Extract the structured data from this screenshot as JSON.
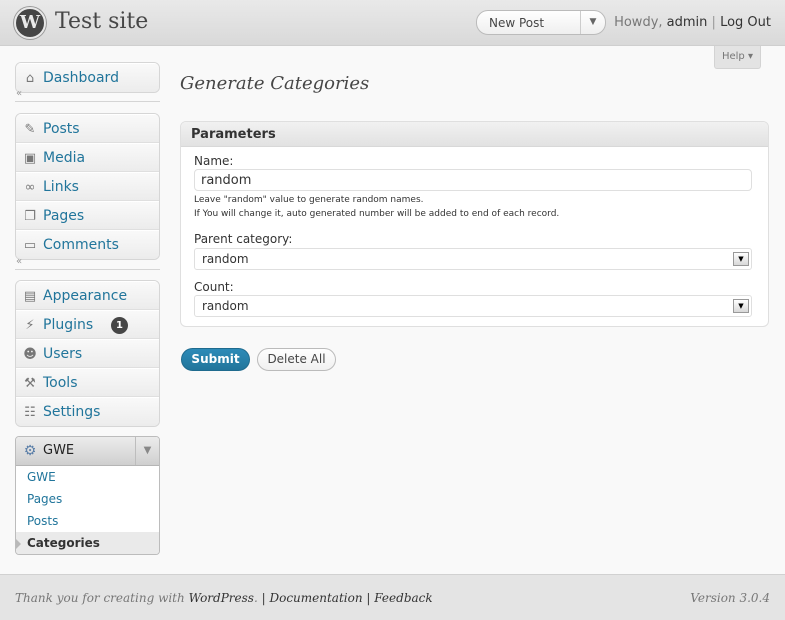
{
  "header": {
    "logo": "W",
    "site_title": "Test site",
    "favorite_action": "New Post",
    "howdy": "Howdy,",
    "user": "admin",
    "separator": "|",
    "logout": "Log Out"
  },
  "help_tab": "Help",
  "sidebar": {
    "group1": [
      {
        "label": "Dashboard",
        "icon": "dashboard-icon"
      }
    ],
    "group2": [
      {
        "label": "Posts",
        "icon": "pushpin-icon"
      },
      {
        "label": "Media",
        "icon": "camera-icon"
      },
      {
        "label": "Links",
        "icon": "link-icon"
      },
      {
        "label": "Pages",
        "icon": "pages-icon"
      },
      {
        "label": "Comments",
        "icon": "comment-bubble-icon"
      }
    ],
    "group3": [
      {
        "label": "Appearance",
        "icon": "appearance-icon"
      },
      {
        "label": "Plugins",
        "icon": "plug-icon",
        "badge": "1"
      },
      {
        "label": "Users",
        "icon": "users-icon"
      },
      {
        "label": "Tools",
        "icon": "tools-icon"
      },
      {
        "label": "Settings",
        "icon": "settings-icon"
      }
    ],
    "gwe": {
      "label": "GWE",
      "icon": "gear-icon",
      "items": [
        "GWE",
        "Pages",
        "Posts",
        "Categories"
      ],
      "current": "Categories"
    }
  },
  "page": {
    "title": "Generate Categories",
    "box_title": "Parameters",
    "name_label": "Name:",
    "name_value": "random",
    "hint_line1": "Leave \"random\" value to generate random names.",
    "hint_line2": "If You will change it, auto generated number will be added to end of each record.",
    "parent_label": "Parent category:",
    "parent_value": "random",
    "count_label": "Count:",
    "count_value": "random",
    "submit_label": "Submit",
    "delete_label": "Delete All"
  },
  "footer": {
    "thanks": "Thank you for creating with",
    "wordpress": "WordPress",
    "documentation": "Documentation",
    "feedback": "Feedback",
    "version": "Version 3.0.4"
  },
  "colors": {
    "link": "#21759b",
    "primary_button": "#21759b",
    "badge": "#464646"
  }
}
